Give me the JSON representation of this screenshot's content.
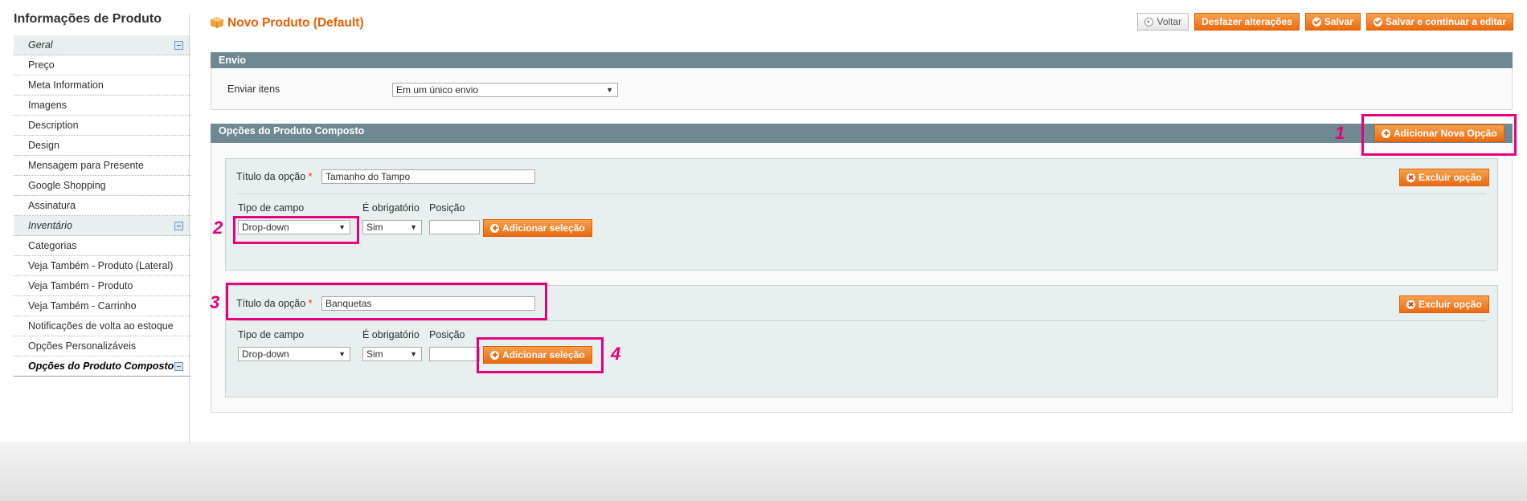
{
  "sidebar": {
    "title": "Informações de Produto",
    "items": [
      {
        "label": "Geral"
      },
      {
        "label": "Preço"
      },
      {
        "label": "Meta Information"
      },
      {
        "label": "Imagens"
      },
      {
        "label": "Description"
      },
      {
        "label": "Design"
      },
      {
        "label": "Mensagem para Presente"
      },
      {
        "label": "Google Shopping"
      },
      {
        "label": "Assinatura"
      },
      {
        "label": "Inventário"
      },
      {
        "label": "Categorias"
      },
      {
        "label": "Veja Também - Produto (Lateral)"
      },
      {
        "label": "Veja Também - Produto"
      },
      {
        "label": "Veja Também - Carrinho"
      },
      {
        "label": "Notificações de volta ao estoque"
      },
      {
        "label": "Opções Personalizáveis"
      },
      {
        "label": "Opções do Produto Composto"
      }
    ]
  },
  "header": {
    "title": "Novo Produto (Default)",
    "buttons": {
      "back": "Voltar",
      "reset": "Desfazer alterações",
      "save": "Salvar",
      "save_continue": "Salvar e continuar a editar"
    }
  },
  "shipping": {
    "title": "Envio",
    "label": "Enviar itens",
    "value": "Em um único envio"
  },
  "bundle": {
    "title": "Opções do Produto Composto",
    "add_option": "Adicionar Nova Opção",
    "options": [
      {
        "title_label": "Título da opção",
        "required_mark": "*",
        "title_value": "Tamanho do Tampo",
        "delete": "Excluir opção",
        "col_type": "Tipo de campo",
        "col_required": "É obrigatório",
        "col_position": "Posição",
        "type_value": "Drop-down",
        "required_value": "Sim",
        "position_value": "",
        "add_selection": "Adicionar seleção"
      },
      {
        "title_label": "Título da opção",
        "required_mark": "*",
        "title_value": "Banquetas",
        "delete": "Excluir opção",
        "col_type": "Tipo de campo",
        "col_required": "É obrigatório",
        "col_position": "Posição",
        "type_value": "Drop-down",
        "required_value": "Sim",
        "position_value": "",
        "add_selection": "Adicionar seleção"
      }
    ]
  },
  "annotations": [
    "1",
    "2",
    "3",
    "4"
  ],
  "colors": {
    "accent": "#eb6a10",
    "title": "#eb5e00",
    "section": "#6f8992",
    "highlight": "#e6007e"
  }
}
